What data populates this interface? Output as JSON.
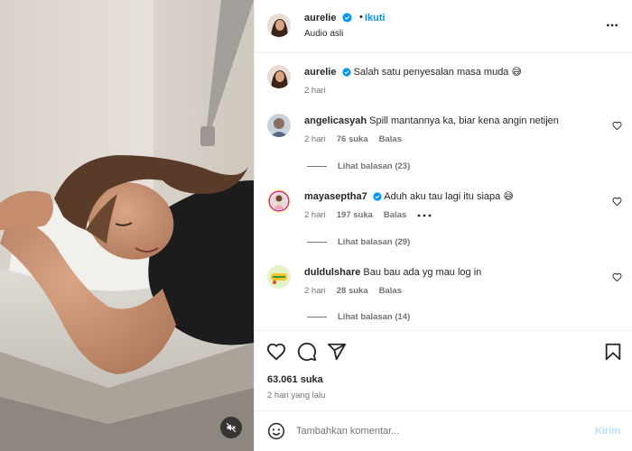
{
  "post": {
    "author": "aurelie",
    "follow_label": "Ikuti",
    "audio_label": "Audio asli",
    "dot_separator": "•",
    "caption": {
      "username": "aurelie",
      "text": "Salah satu penyesalan masa muda 😅",
      "time": "2 hari"
    }
  },
  "comments": [
    {
      "username": "angelicasyah",
      "text": "Spill mantannya ka, biar kena angin netijen",
      "time": "2 hari",
      "likes": "76 suka",
      "reply_label": "Balas",
      "view_replies": "Lihat balasan (23)"
    },
    {
      "username": "mayaseptha7",
      "text": "Aduh aku tau lagi itu siapa 😅",
      "time": "2 hari",
      "likes": "197 suka",
      "reply_label": "Balas",
      "view_replies": "Lihat balasan (29)"
    },
    {
      "username": "duldulshare",
      "text": "Bau bau ada yg mau log in",
      "time": "2 hari",
      "likes": "28 suka",
      "reply_label": "Balas",
      "view_replies": "Lihat balasan (14)"
    }
  ],
  "stats": {
    "likes": "63.061 suka",
    "time": "2 hari yang lalu"
  },
  "composer": {
    "placeholder": "Tambahkan komentar...",
    "post_label": "Kirim"
  },
  "icons": {
    "more": "more-horizontal-icon",
    "like": "heart-icon",
    "comment": "comment-icon",
    "share": "share-icon",
    "save": "bookmark-icon",
    "emoji": "emoji-icon",
    "mute": "muted-speaker-icon",
    "verified": "verified-badge-icon"
  },
  "colors": {
    "link": "#0095f6",
    "verified": "#0095f6",
    "secondary_text": "#737373",
    "post_disabled": "#b2dffc"
  }
}
